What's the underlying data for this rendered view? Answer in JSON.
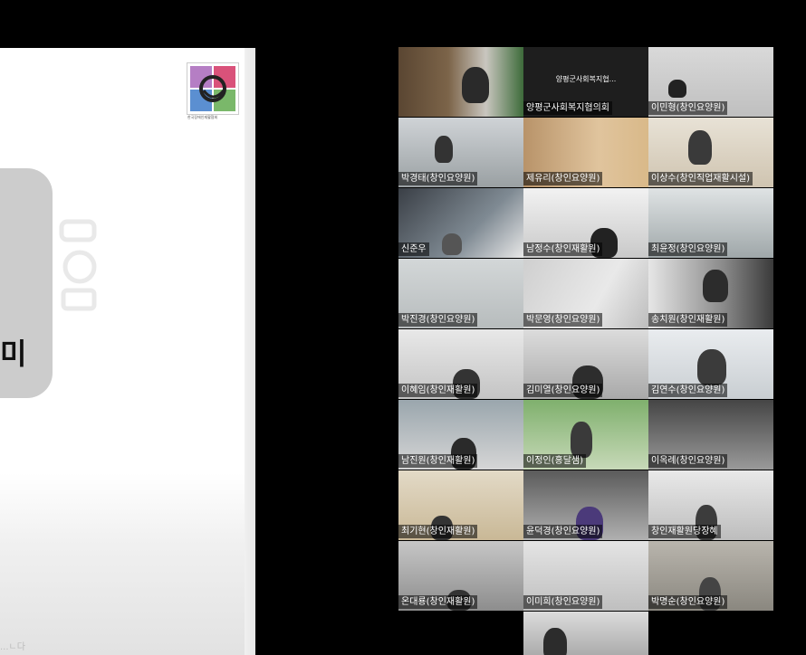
{
  "presentation": {
    "logo_caption": "한국장애인재활협회",
    "card_text": "미",
    "footnote": "...ㄴ다"
  },
  "gallery": {
    "participants": [
      {
        "name": "",
        "video": "on"
      },
      {
        "name": "양평군사회복지협의회",
        "video": "off",
        "center_label": "양평군사회복지협..."
      },
      {
        "name": "이민형(창인요양원)",
        "video": "on"
      },
      {
        "name": "박경태(창인요양원)",
        "video": "on"
      },
      {
        "name": "제유리(창인요양원)",
        "video": "on"
      },
      {
        "name": "이상수(창인직업재활시설)",
        "video": "on"
      },
      {
        "name": "신준우",
        "video": "on"
      },
      {
        "name": "남정수(창인재활원)",
        "video": "on"
      },
      {
        "name": "최윤정(창인요양원)",
        "video": "on"
      },
      {
        "name": "박진경(창인요양원)",
        "video": "on"
      },
      {
        "name": "박문영(창인요양원)",
        "video": "on"
      },
      {
        "name": "송치원(창인재활원)",
        "video": "on"
      },
      {
        "name": "이혜임(창인재활원)",
        "video": "on"
      },
      {
        "name": "김미열(창인요양원)",
        "video": "on"
      },
      {
        "name": "김연수(창인요양원)",
        "video": "on"
      },
      {
        "name": "남진원(창인재활원)",
        "video": "on"
      },
      {
        "name": "이정인(홍달샘)",
        "video": "on"
      },
      {
        "name": "이옥례(창인요양원)",
        "video": "on"
      },
      {
        "name": "최기현(창인재활원)",
        "video": "on"
      },
      {
        "name": "윤덕경(창인요양원)",
        "video": "on"
      },
      {
        "name": "창인재활원당장혜",
        "video": "on"
      },
      {
        "name": "온대룡(창인재활원)",
        "video": "on"
      },
      {
        "name": "이미희(창인요양원)",
        "video": "on"
      },
      {
        "name": "박명순(창인요양원)",
        "video": "on"
      },
      {
        "name": "",
        "video": "on"
      }
    ]
  }
}
